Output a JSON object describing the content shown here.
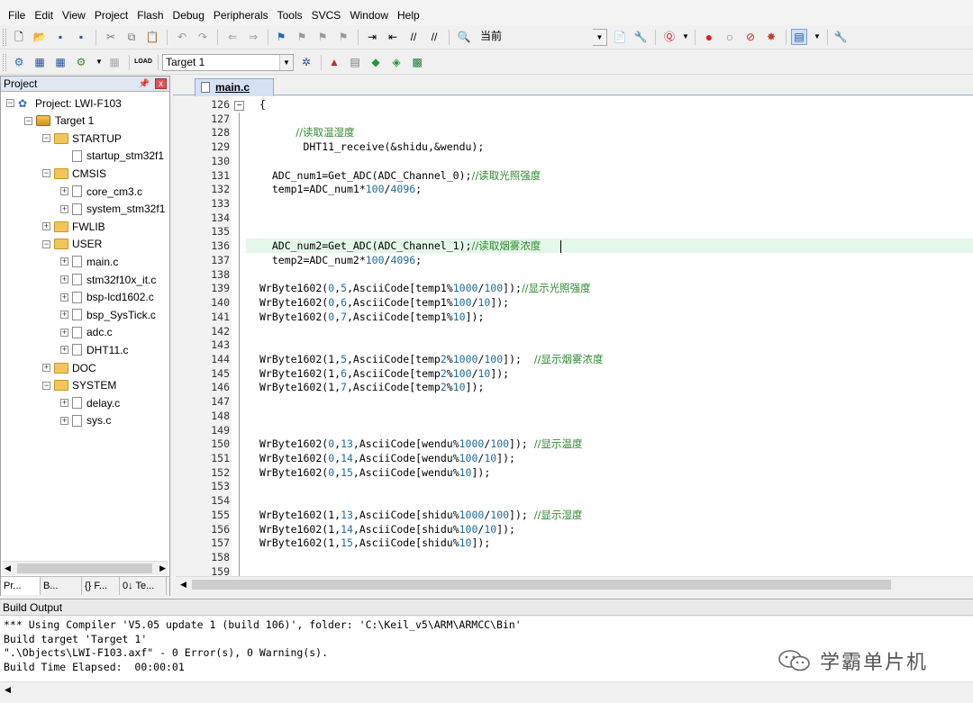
{
  "menu": [
    "File",
    "Edit",
    "View",
    "Project",
    "Flash",
    "Debug",
    "Peripherals",
    "Tools",
    "SVCS",
    "Window",
    "Help"
  ],
  "toolbar1": {
    "find_combo": "当前"
  },
  "toolbar2": {
    "target_combo": "Target 1",
    "load_label": "LOAD"
  },
  "project_panel": {
    "title": "Project",
    "pin": "ᵃ",
    "close": "x",
    "tree": [
      {
        "label": "Project: LWI-F103",
        "level": 0,
        "kind": "project",
        "exp": "−"
      },
      {
        "label": "Target 1",
        "level": 1,
        "kind": "target",
        "exp": "−"
      },
      {
        "label": "STARTUP",
        "level": 2,
        "kind": "folder",
        "exp": "−"
      },
      {
        "label": "startup_stm32f1",
        "level": 3,
        "kind": "file",
        "exp": ""
      },
      {
        "label": "CMSIS",
        "level": 2,
        "kind": "folder",
        "exp": "−"
      },
      {
        "label": "core_cm3.c",
        "level": 3,
        "kind": "file",
        "exp": "+"
      },
      {
        "label": "system_stm32f1",
        "level": 3,
        "kind": "file",
        "exp": "+"
      },
      {
        "label": "FWLIB",
        "level": 2,
        "kind": "folder",
        "exp": "+"
      },
      {
        "label": "USER",
        "level": 2,
        "kind": "folder",
        "exp": "−"
      },
      {
        "label": "main.c",
        "level": 3,
        "kind": "file",
        "exp": "+"
      },
      {
        "label": "stm32f10x_it.c",
        "level": 3,
        "kind": "file",
        "exp": "+"
      },
      {
        "label": "bsp-lcd1602.c",
        "level": 3,
        "kind": "file",
        "exp": "+"
      },
      {
        "label": "bsp_SysTick.c",
        "level": 3,
        "kind": "file",
        "exp": "+"
      },
      {
        "label": "adc.c",
        "level": 3,
        "kind": "file",
        "exp": "+"
      },
      {
        "label": "DHT11.c",
        "level": 3,
        "kind": "file",
        "exp": "+"
      },
      {
        "label": "DOC",
        "level": 2,
        "kind": "folder",
        "exp": "+"
      },
      {
        "label": "SYSTEM",
        "level": 2,
        "kind": "folder",
        "exp": "−"
      },
      {
        "label": "delay.c",
        "level": 3,
        "kind": "file",
        "exp": "+"
      },
      {
        "label": "sys.c",
        "level": 3,
        "kind": "file",
        "exp": "+"
      }
    ],
    "tabs": [
      "Pr...",
      "B...",
      "{} F...",
      "0↓ Te..."
    ]
  },
  "editor": {
    "tab_label": "main.c",
    "fold_symbol": "−",
    "lines": [
      {
        "n": "126",
        "code": "{"
      },
      {
        "n": "127",
        "code": ""
      },
      {
        "n": "128",
        "code": "",
        "comment": "           //读取温湿度"
      },
      {
        "n": "129",
        "code": "       DHT11_receive(&shidu,&wendu);"
      },
      {
        "n": "130",
        "code": ""
      },
      {
        "n": "131",
        "code": "  ADC_num1=Get_ADC(ADC_Channel_0);",
        "comment": "//读取光照强度"
      },
      {
        "n": "132",
        "code": "  temp1=ADC_num1*100/4096;"
      },
      {
        "n": "133",
        "code": ""
      },
      {
        "n": "134",
        "code": ""
      },
      {
        "n": "135",
        "code": ""
      },
      {
        "n": "136",
        "code": "  ADC_num2=Get_ADC(ADC_Channel_1);",
        "comment": "//读取烟雾浓度"
      },
      {
        "n": "137",
        "code": "  temp2=ADC_num2*100/4096;"
      },
      {
        "n": "138",
        "code": ""
      },
      {
        "n": "139",
        "code": "WrByte1602(0,5,AsciiCode[temp1%1000/100]);",
        "comment": "//显示光照强度"
      },
      {
        "n": "140",
        "code": "WrByte1602(0,6,AsciiCode[temp1%100/10]);"
      },
      {
        "n": "141",
        "code": "WrByte1602(0,7,AsciiCode[temp1%10]);"
      },
      {
        "n": "142",
        "code": ""
      },
      {
        "n": "143",
        "code": ""
      },
      {
        "n": "144",
        "code": "WrByte1602(1,5,AsciiCode[temp2%1000/100]);  ",
        "comment": "//显示烟雾浓度"
      },
      {
        "n": "145",
        "code": "WrByte1602(1,6,AsciiCode[temp2%100/10]);"
      },
      {
        "n": "146",
        "code": "WrByte1602(1,7,AsciiCode[temp2%10]);"
      },
      {
        "n": "147",
        "code": ""
      },
      {
        "n": "148",
        "code": ""
      },
      {
        "n": "149",
        "code": ""
      },
      {
        "n": "150",
        "code": "WrByte1602(0,13,AsciiCode[wendu%1000/100]); ",
        "comment": "//显示温度"
      },
      {
        "n": "151",
        "code": "WrByte1602(0,14,AsciiCode[wendu%100/10]);"
      },
      {
        "n": "152",
        "code": "WrByte1602(0,15,AsciiCode[wendu%10]);"
      },
      {
        "n": "153",
        "code": ""
      },
      {
        "n": "154",
        "code": ""
      },
      {
        "n": "155",
        "code": "WrByte1602(1,13,AsciiCode[shidu%1000/100]); ",
        "comment": "//显示湿度"
      },
      {
        "n": "156",
        "code": "WrByte1602(1,14,AsciiCode[shidu%100/10]);"
      },
      {
        "n": "157",
        "code": "WrByte1602(1,15,AsciiCode[shidu%10]);"
      },
      {
        "n": "158",
        "code": ""
      },
      {
        "n": "159",
        "code": ""
      }
    ]
  },
  "build_output": {
    "title": "Build Output",
    "lines": [
      "*** Using Compiler 'V5.05 update 1 (build 106)', folder: 'C:\\Keil_v5\\ARM\\ARMCC\\Bin'",
      "Build target 'Target 1'",
      "\".\\Objects\\LWI-F103.axf\" - 0 Error(s), 0 Warning(s).",
      "Build Time Elapsed:  00:00:01"
    ]
  },
  "watermark": "学霸单片机",
  "colors": {
    "comment": "#2e8b2e",
    "number": "#1c6c9c",
    "highlight_line": "#e4f7e8"
  }
}
